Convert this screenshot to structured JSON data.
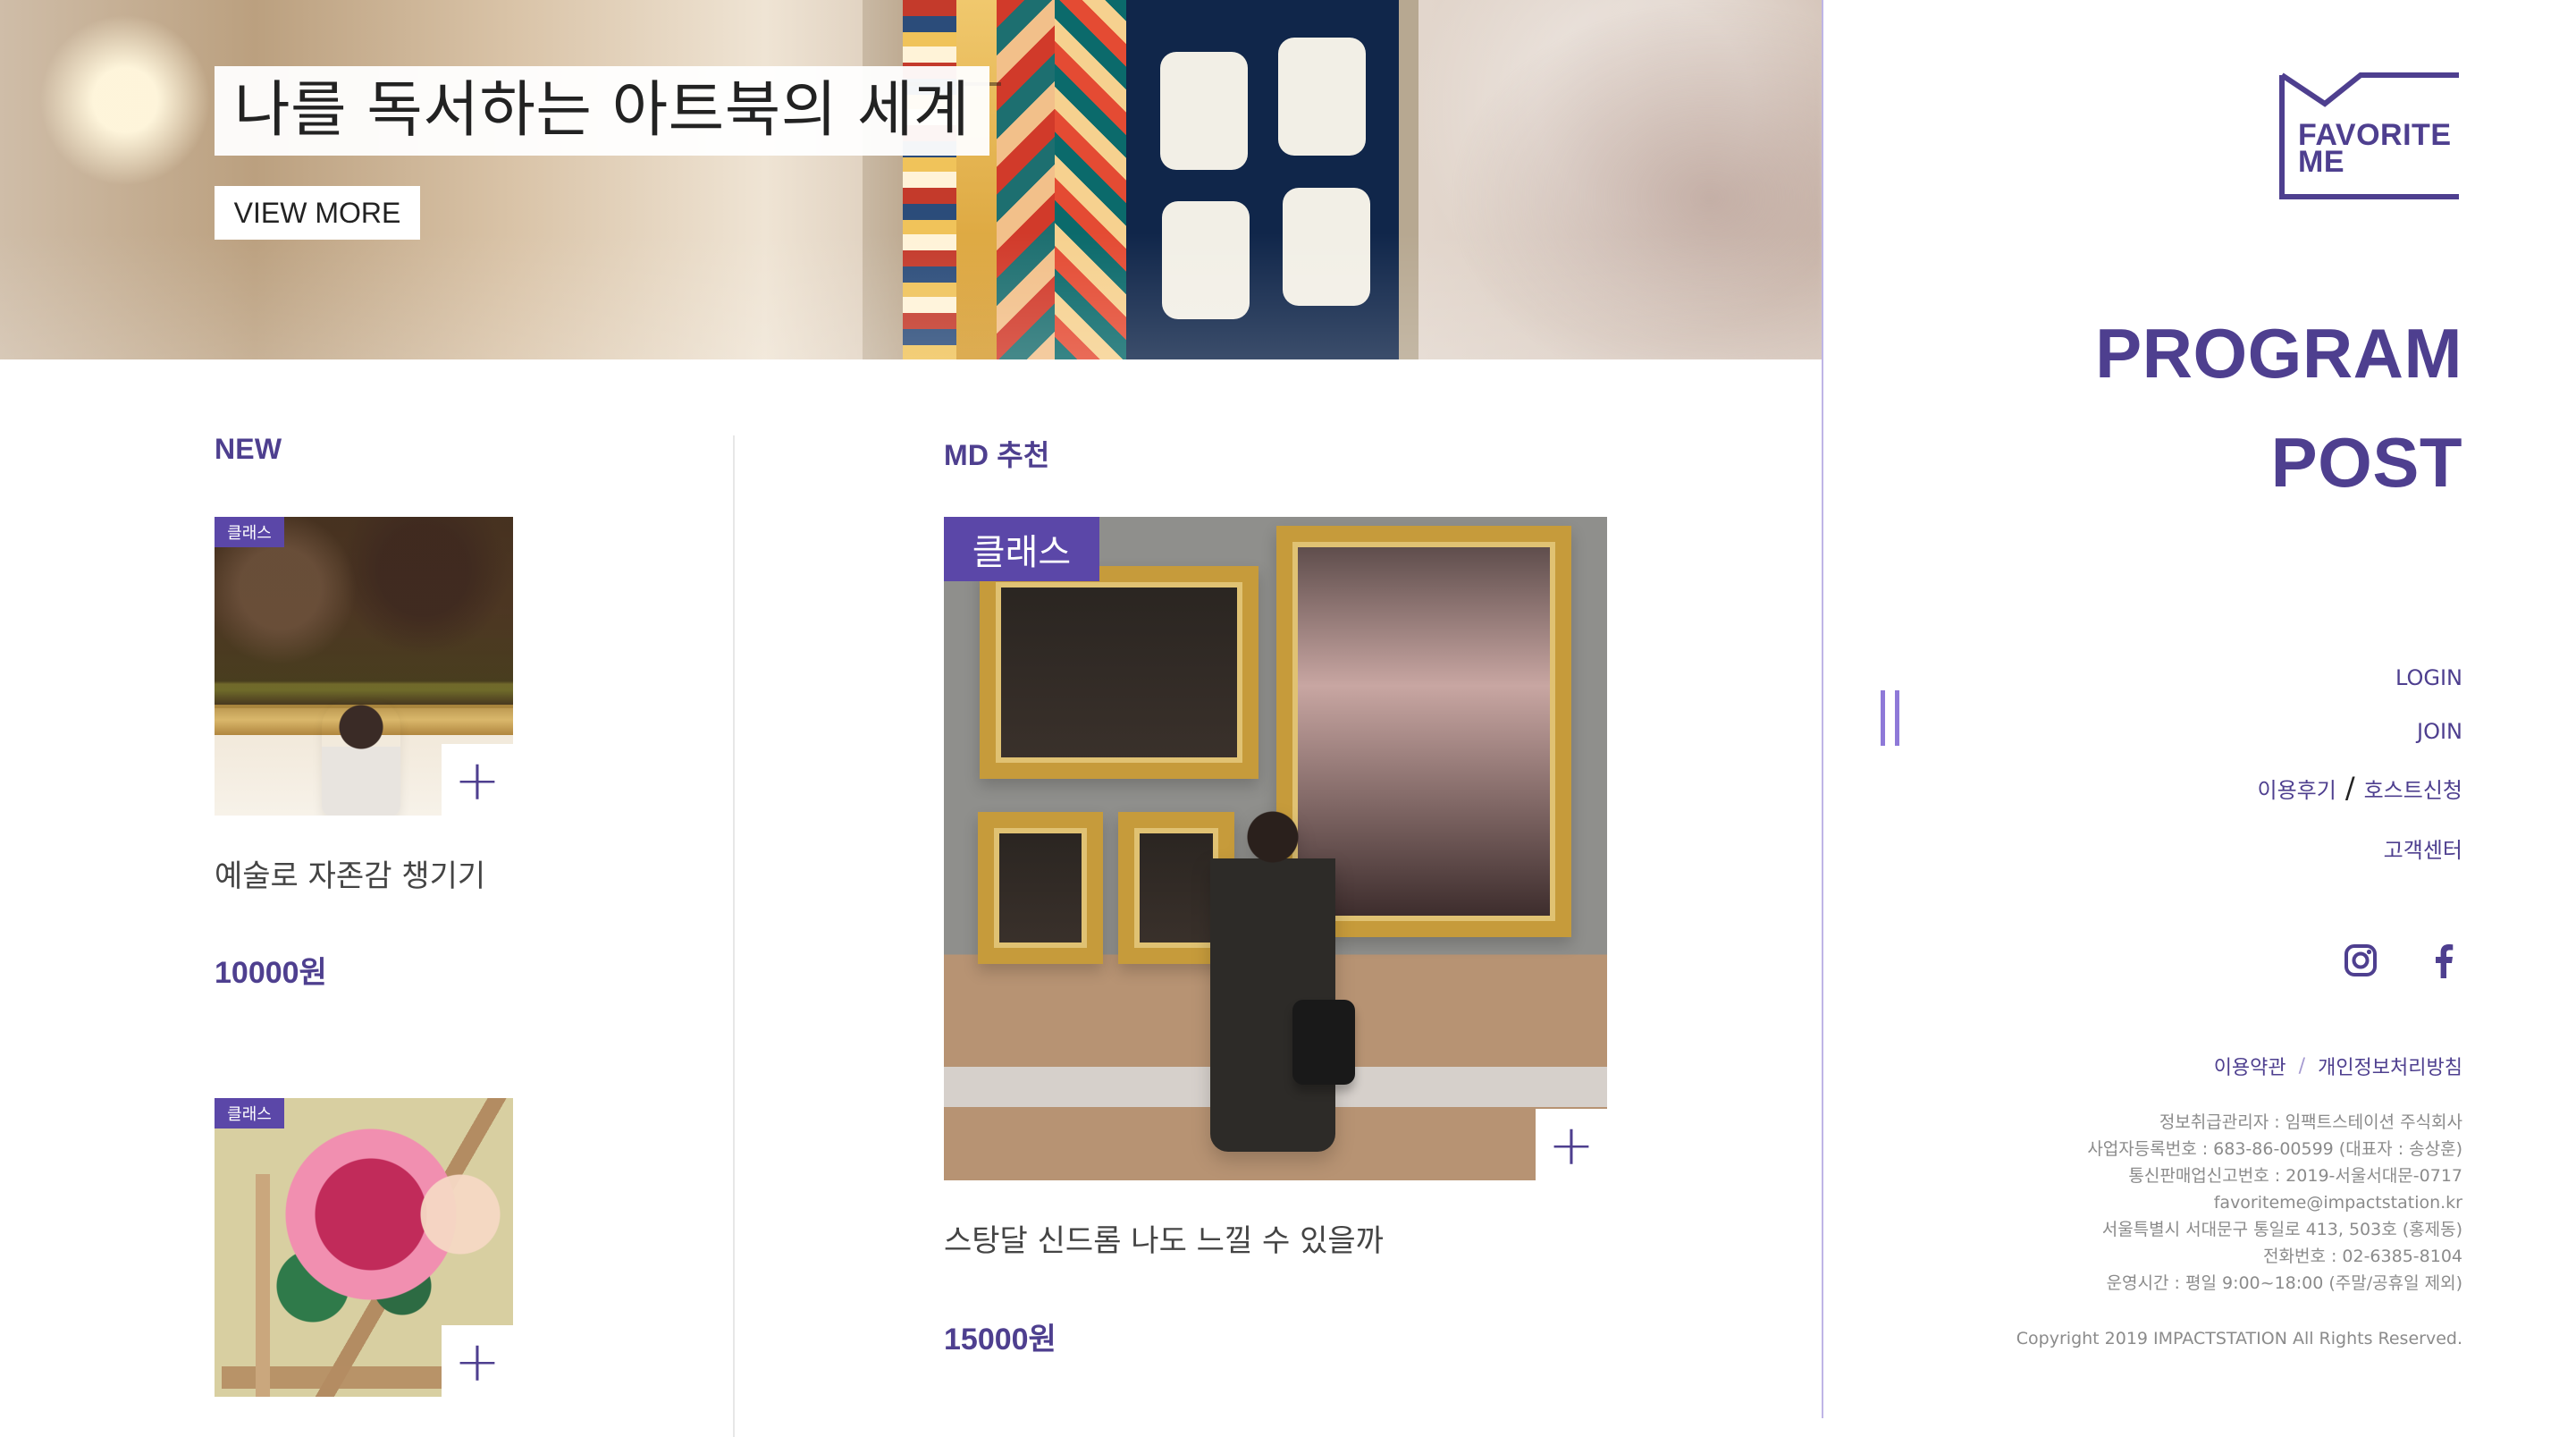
{
  "hero": {
    "title": "나를 독서하는 아트북의 세계",
    "cta_label": "VIEW MORE"
  },
  "sections": {
    "new_title": "NEW",
    "md_title": "MD 추천"
  },
  "cards": {
    "new": [
      {
        "badge": "클래스",
        "name": "예술로 자존감 챙기기",
        "price": "10000원"
      },
      {
        "badge": "클래스"
      }
    ],
    "md": {
      "badge": "클래스",
      "name": "스탕달 신드롬 나도 느낄 수 있을까",
      "price": "15000원"
    }
  },
  "sidebar": {
    "logo_line1": "FAVORITE",
    "logo_line2": "ME",
    "nav": {
      "program": "PROGRAM",
      "post": "POST"
    },
    "links": {
      "login": "LOGIN",
      "join": "JOIN",
      "review": "이용후기",
      "slash": "/",
      "host_apply": "호스트신청",
      "support": "고객센터"
    },
    "policy": {
      "terms": "이용약관",
      "sep": "/",
      "privacy": "개인정보처리방침"
    },
    "info_lines": [
      "정보취급관리자 : 임팩트스테이션 주식회사",
      "사업자등록번호 : 683-86-00599 (대표자 : 송상훈)",
      "통신판매업신고번호 : 2019-서울서대문-0717",
      "favoriteme@impactstation.kr",
      "서울특별시 서대문구 통일로 413, 503호 (홍제동)",
      "전화번호 : 02-6385-8104",
      "운영시간 : 평일 9:00~18:00 (주말/공휴일 제외)"
    ],
    "copyright": "Copyright 2019 IMPACTSTATION All Rights Reserved."
  },
  "colors": {
    "primary": "#4e3f8f",
    "badge": "#5b47a8",
    "divider": "#bfb5e6"
  },
  "icons": {
    "add": "plus-icon",
    "instagram": "instagram-icon",
    "facebook": "facebook-icon",
    "menu": "double-vertical-bars-icon"
  }
}
